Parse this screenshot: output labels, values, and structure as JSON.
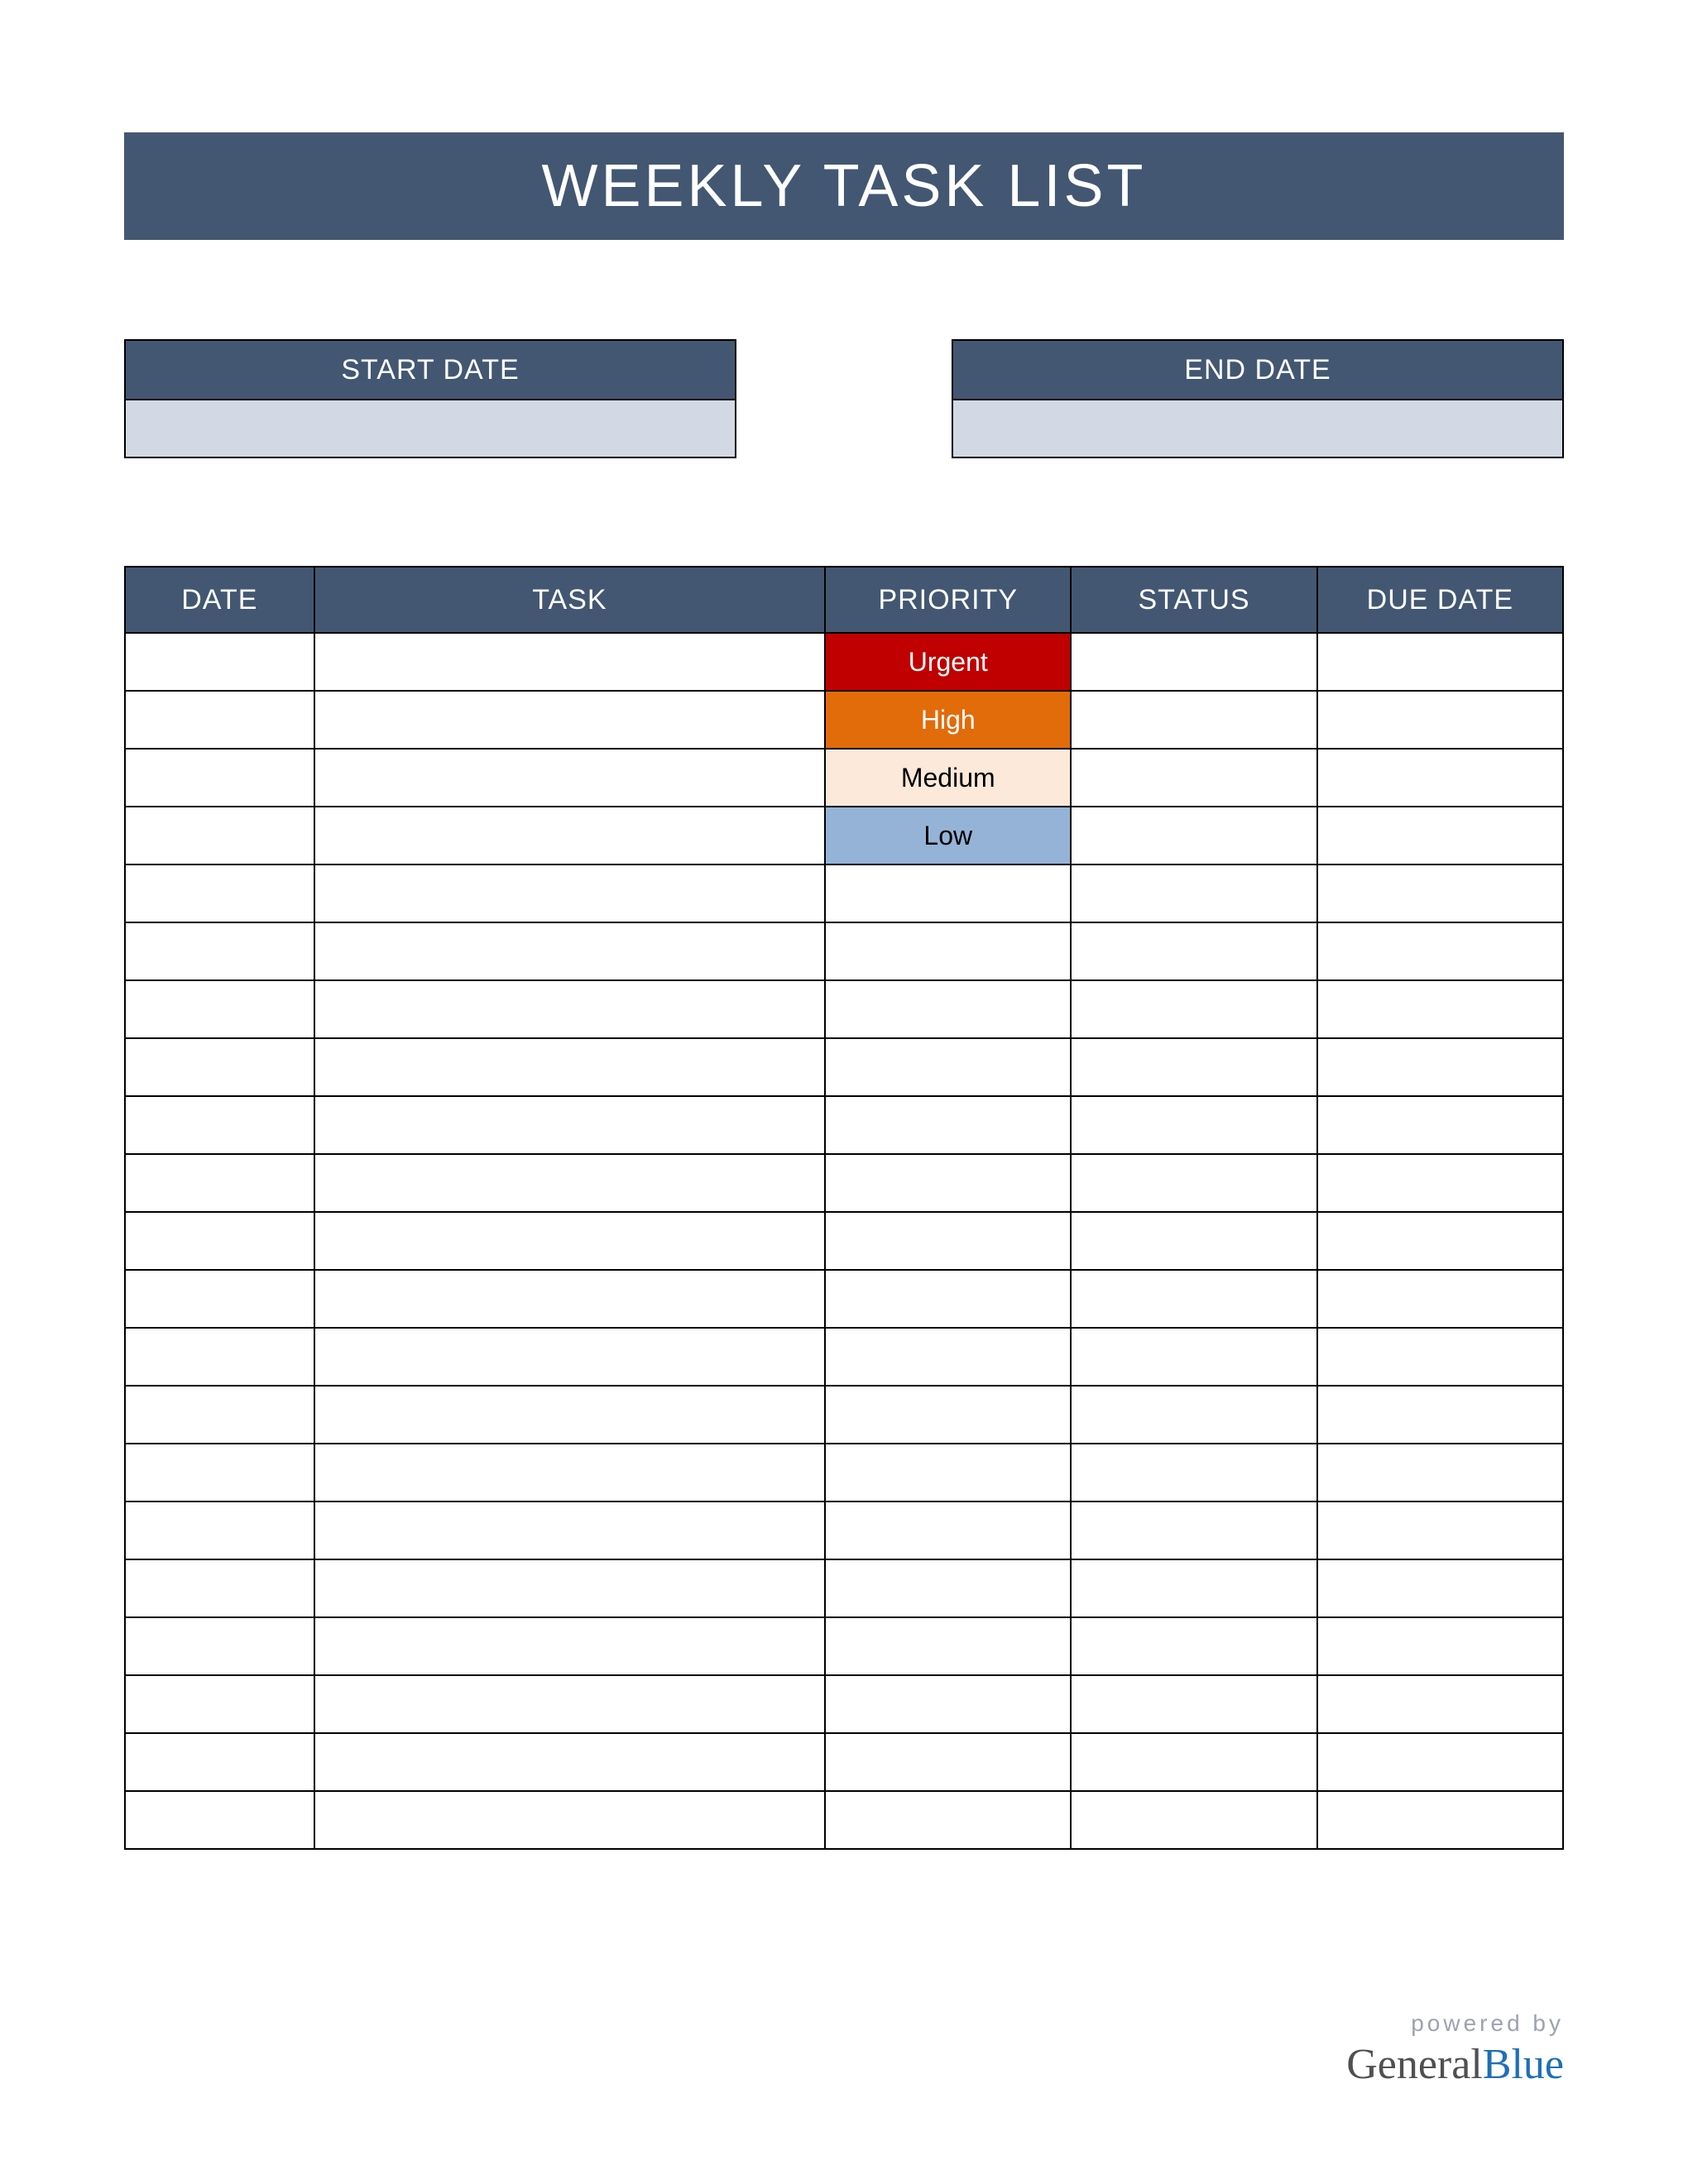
{
  "title": "WEEKLY TASK LIST",
  "dates": {
    "start_label": "START DATE",
    "start_value": "",
    "end_label": "END DATE",
    "end_value": ""
  },
  "columns": {
    "date": "DATE",
    "task": "TASK",
    "priority": "PRIORITY",
    "status": "STATUS",
    "due": "DUE DATE"
  },
  "rows": [
    {
      "date": "",
      "task": "",
      "priority": "Urgent",
      "priority_class": "priority-urgent",
      "status": "",
      "due": ""
    },
    {
      "date": "",
      "task": "",
      "priority": "High",
      "priority_class": "priority-high",
      "status": "",
      "due": ""
    },
    {
      "date": "",
      "task": "",
      "priority": "Medium",
      "priority_class": "priority-medium",
      "status": "",
      "due": ""
    },
    {
      "date": "",
      "task": "",
      "priority": "Low",
      "priority_class": "priority-low",
      "status": "",
      "due": ""
    },
    {
      "date": "",
      "task": "",
      "priority": "",
      "priority_class": "",
      "status": "",
      "due": ""
    },
    {
      "date": "",
      "task": "",
      "priority": "",
      "priority_class": "",
      "status": "",
      "due": ""
    },
    {
      "date": "",
      "task": "",
      "priority": "",
      "priority_class": "",
      "status": "",
      "due": ""
    },
    {
      "date": "",
      "task": "",
      "priority": "",
      "priority_class": "",
      "status": "",
      "due": ""
    },
    {
      "date": "",
      "task": "",
      "priority": "",
      "priority_class": "",
      "status": "",
      "due": ""
    },
    {
      "date": "",
      "task": "",
      "priority": "",
      "priority_class": "",
      "status": "",
      "due": ""
    },
    {
      "date": "",
      "task": "",
      "priority": "",
      "priority_class": "",
      "status": "",
      "due": ""
    },
    {
      "date": "",
      "task": "",
      "priority": "",
      "priority_class": "",
      "status": "",
      "due": ""
    },
    {
      "date": "",
      "task": "",
      "priority": "",
      "priority_class": "",
      "status": "",
      "due": ""
    },
    {
      "date": "",
      "task": "",
      "priority": "",
      "priority_class": "",
      "status": "",
      "due": ""
    },
    {
      "date": "",
      "task": "",
      "priority": "",
      "priority_class": "",
      "status": "",
      "due": ""
    },
    {
      "date": "",
      "task": "",
      "priority": "",
      "priority_class": "",
      "status": "",
      "due": ""
    },
    {
      "date": "",
      "task": "",
      "priority": "",
      "priority_class": "",
      "status": "",
      "due": ""
    },
    {
      "date": "",
      "task": "",
      "priority": "",
      "priority_class": "",
      "status": "",
      "due": ""
    },
    {
      "date": "",
      "task": "",
      "priority": "",
      "priority_class": "",
      "status": "",
      "due": ""
    },
    {
      "date": "",
      "task": "",
      "priority": "",
      "priority_class": "",
      "status": "",
      "due": ""
    },
    {
      "date": "",
      "task": "",
      "priority": "",
      "priority_class": "",
      "status": "",
      "due": ""
    }
  ],
  "footer": {
    "powered": "powered by",
    "brand1": "General",
    "brand2": "Blue"
  }
}
